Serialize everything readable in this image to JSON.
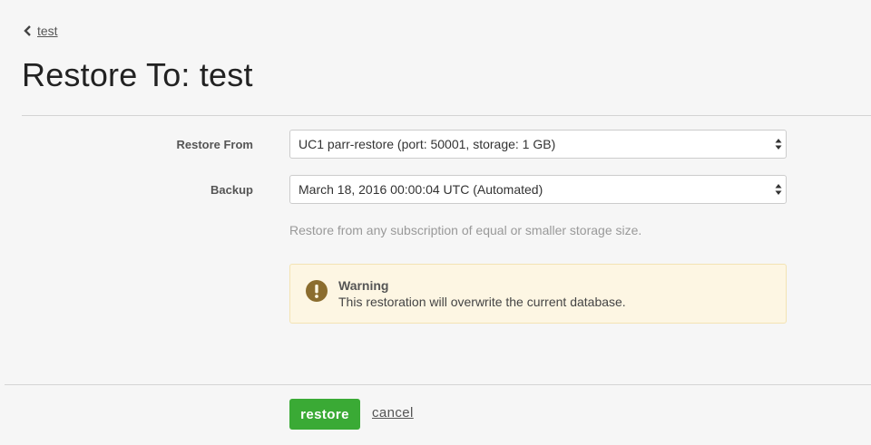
{
  "back_link": {
    "label": "test",
    "icon": "chevron-left-icon"
  },
  "page_title": "Restore To: test",
  "form": {
    "restore_from": {
      "label": "Restore From",
      "value": "UC1 parr-restore (port: 50001, storage: 1 GB)"
    },
    "backup": {
      "label": "Backup",
      "value": "March 18, 2016 00:00:04 UTC (Automated)"
    },
    "hint": "Restore from any subscription of equal or smaller storage size."
  },
  "warning": {
    "title": "Warning",
    "message": "This restoration will overwrite the current database.",
    "icon": "exclamation-icon",
    "icon_color": "#8b6d2f",
    "background": "#fdf6e3"
  },
  "actions": {
    "restore_label": "restore",
    "cancel_label": "cancel",
    "restore_color": "#3aaa35"
  }
}
